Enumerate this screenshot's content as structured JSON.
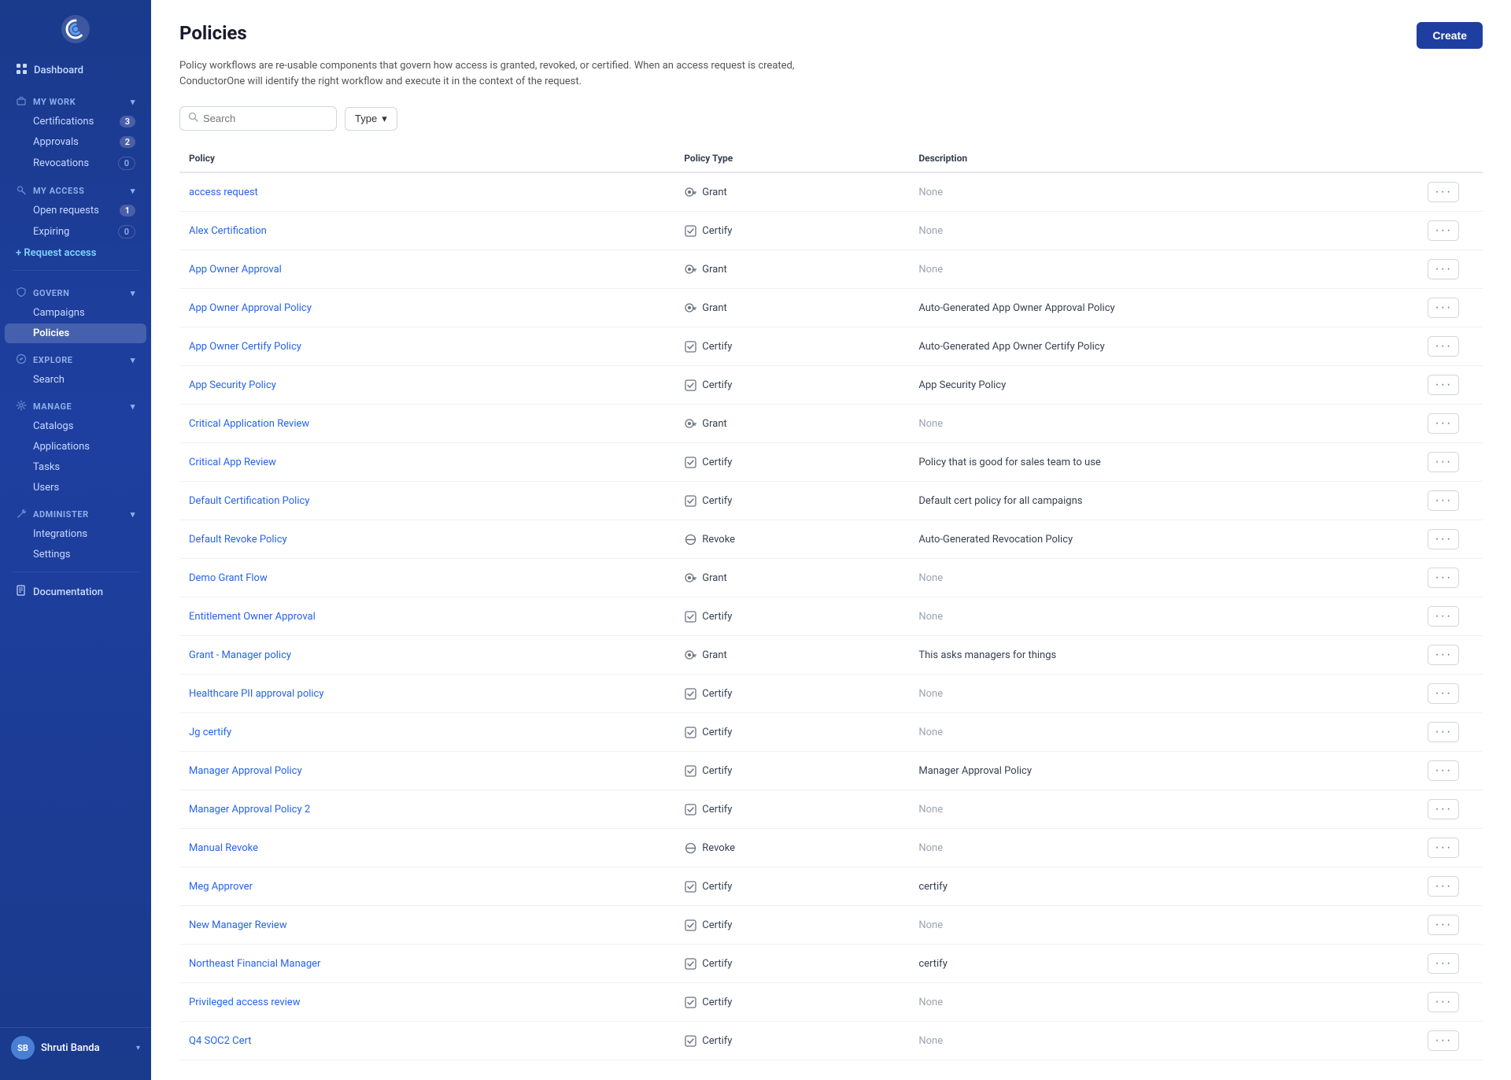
{
  "sidebar": {
    "logo_alt": "ConductorOne Logo",
    "nav": [
      {
        "id": "dashboard",
        "label": "Dashboard",
        "icon": "grid-icon",
        "type": "item",
        "active": false
      },
      {
        "id": "my-work",
        "label": "My work",
        "icon": "briefcase-icon",
        "type": "header",
        "children": [
          {
            "id": "certifications",
            "label": "Certifications",
            "badge": "3",
            "badge_zero": false
          },
          {
            "id": "approvals",
            "label": "Approvals",
            "badge": "2",
            "badge_zero": false
          },
          {
            "id": "revocations",
            "label": "Revocations",
            "badge": "0",
            "badge_zero": true
          }
        ]
      },
      {
        "id": "my-access",
        "label": "My access",
        "icon": "key-icon",
        "type": "header",
        "children": [
          {
            "id": "open-requests",
            "label": "Open requests",
            "badge": "1",
            "badge_zero": false
          },
          {
            "id": "expiring",
            "label": "Expiring",
            "badge": "0",
            "badge_zero": true
          }
        ]
      },
      {
        "id": "request-access",
        "label": "+ Request access",
        "icon": "",
        "type": "button-item"
      },
      {
        "id": "govern",
        "label": "GOVERN",
        "icon": "shield-icon",
        "type": "header",
        "children": [
          {
            "id": "campaigns",
            "label": "Campaigns",
            "badge": null
          },
          {
            "id": "policies",
            "label": "Policies",
            "badge": null,
            "active": true
          }
        ]
      },
      {
        "id": "explore",
        "label": "EXPLORE",
        "icon": "compass-icon",
        "type": "header",
        "children": [
          {
            "id": "search",
            "label": "Search",
            "badge": null
          }
        ]
      },
      {
        "id": "manage",
        "label": "MANAGE",
        "icon": "settings-icon",
        "type": "header",
        "children": [
          {
            "id": "catalogs",
            "label": "Catalogs",
            "badge": null
          },
          {
            "id": "applications",
            "label": "Applications",
            "badge": null
          },
          {
            "id": "tasks",
            "label": "Tasks",
            "badge": null
          },
          {
            "id": "users",
            "label": "Users",
            "badge": null
          }
        ]
      },
      {
        "id": "administer",
        "label": "ADMINISTER",
        "icon": "tool-icon",
        "type": "header",
        "children": [
          {
            "id": "integrations",
            "label": "Integrations",
            "badge": null
          },
          {
            "id": "settings",
            "label": "Settings",
            "badge": null
          }
        ]
      },
      {
        "id": "documentation",
        "label": "Documentation",
        "icon": "book-icon",
        "type": "item"
      }
    ],
    "user": {
      "initials": "SB",
      "name": "Shruti Banda"
    }
  },
  "page": {
    "title": "Policies",
    "description": "Policy workflows are re-usable components that govern how access is granted, revoked, or certified. When an access request is created, ConductorOne will identify the right workflow and execute it in the context of the request.",
    "create_button": "Create",
    "search_placeholder": "Search",
    "type_filter_label": "Type"
  },
  "table": {
    "columns": [
      {
        "id": "policy",
        "label": "Policy"
      },
      {
        "id": "policy_type",
        "label": "Policy Type"
      },
      {
        "id": "description",
        "label": "Description"
      },
      {
        "id": "actions",
        "label": ""
      }
    ],
    "rows": [
      {
        "id": 1,
        "policy": "access request",
        "policy_type": "Grant",
        "type_icon": "key",
        "description": "None",
        "desc_is_none": true
      },
      {
        "id": 2,
        "policy": "Alex Certification",
        "policy_type": "Certify",
        "type_icon": "certify",
        "description": "None",
        "desc_is_none": true
      },
      {
        "id": 3,
        "policy": "App Owner Approval",
        "policy_type": "Grant",
        "type_icon": "key",
        "description": "None",
        "desc_is_none": true
      },
      {
        "id": 4,
        "policy": "App Owner Approval Policy",
        "policy_type": "Grant",
        "type_icon": "key",
        "description": "Auto-Generated App Owner Approval Policy",
        "desc_is_none": false
      },
      {
        "id": 5,
        "policy": "App Owner Certify Policy",
        "policy_type": "Certify",
        "type_icon": "certify",
        "description": "Auto-Generated App Owner Certify Policy",
        "desc_is_none": false
      },
      {
        "id": 6,
        "policy": "App Security Policy",
        "policy_type": "Certify",
        "type_icon": "certify",
        "description": "App Security Policy",
        "desc_is_none": false
      },
      {
        "id": 7,
        "policy": "Critical Application Review",
        "policy_type": "Grant",
        "type_icon": "key",
        "description": "None",
        "desc_is_none": true
      },
      {
        "id": 8,
        "policy": "Critical App Review",
        "policy_type": "Certify",
        "type_icon": "certify",
        "description": "Policy that is good for sales team to use",
        "desc_is_none": false
      },
      {
        "id": 9,
        "policy": "Default Certification Policy",
        "policy_type": "Certify",
        "type_icon": "certify",
        "description": "Default cert policy for all campaigns",
        "desc_is_none": false
      },
      {
        "id": 10,
        "policy": "Default Revoke Policy",
        "policy_type": "Revoke",
        "type_icon": "revoke",
        "description": "Auto-Generated Revocation Policy",
        "desc_is_none": false
      },
      {
        "id": 11,
        "policy": "Demo Grant Flow",
        "policy_type": "Grant",
        "type_icon": "key",
        "description": "None",
        "desc_is_none": true
      },
      {
        "id": 12,
        "policy": "Entitlement Owner Approval",
        "policy_type": "Certify",
        "type_icon": "certify",
        "description": "None",
        "desc_is_none": true
      },
      {
        "id": 13,
        "policy": "Grant - Manager policy",
        "policy_type": "Grant",
        "type_icon": "key",
        "description": "This asks managers for things",
        "desc_is_none": false
      },
      {
        "id": 14,
        "policy": "Healthcare PII approval policy",
        "policy_type": "Certify",
        "type_icon": "certify",
        "description": "None",
        "desc_is_none": true
      },
      {
        "id": 15,
        "policy": "Jg certify",
        "policy_type": "Certify",
        "type_icon": "certify",
        "description": "None",
        "desc_is_none": true
      },
      {
        "id": 16,
        "policy": "Manager Approval Policy",
        "policy_type": "Certify",
        "type_icon": "certify",
        "description": "Manager Approval Policy",
        "desc_is_none": false
      },
      {
        "id": 17,
        "policy": "Manager Approval Policy 2",
        "policy_type": "Certify",
        "type_icon": "certify",
        "description": "None",
        "desc_is_none": true
      },
      {
        "id": 18,
        "policy": "Manual Revoke",
        "policy_type": "Revoke",
        "type_icon": "revoke",
        "description": "None",
        "desc_is_none": true
      },
      {
        "id": 19,
        "policy": "Meg Approver",
        "policy_type": "Certify",
        "type_icon": "certify",
        "description": "certify",
        "desc_is_none": false
      },
      {
        "id": 20,
        "policy": "New Manager Review",
        "policy_type": "Certify",
        "type_icon": "certify",
        "description": "None",
        "desc_is_none": true
      },
      {
        "id": 21,
        "policy": "Northeast Financial Manager",
        "policy_type": "Certify",
        "type_icon": "certify",
        "description": "certify",
        "desc_is_none": false
      },
      {
        "id": 22,
        "policy": "Privileged access review",
        "policy_type": "Certify",
        "type_icon": "certify",
        "description": "None",
        "desc_is_none": true
      },
      {
        "id": 23,
        "policy": "Q4 SOC2 Cert",
        "policy_type": "Certify",
        "type_icon": "certify",
        "description": "None",
        "desc_is_none": true
      }
    ]
  }
}
